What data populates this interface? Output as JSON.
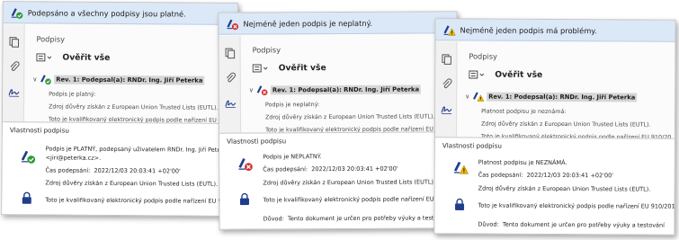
{
  "colors": {
    "status_bar": "#dbe8f7",
    "valid": "#2e9b3a",
    "invalid": "#d32f2f",
    "warning": "#f2b400",
    "pen": "#1f3d8a"
  },
  "panels": [
    {
      "status_text": "Podepsáno a všechny podpisy jsou platné.",
      "status_icon": "signature-valid-icon",
      "panel_title": "Podpisy",
      "verify_label": "Ověřit vše",
      "revision_label": "Rev. 1: Podepsal(a): RNDr. Ing. Jiří Peterka",
      "details": [
        "Podpis je platný:",
        "Zdroj důvěry získán z European Union Trusted Lists (EUTL).",
        "Toto je kvalifikovaný elektronický podpis podle nařízení EU 910/2"
      ],
      "dialog": {
        "title": "Vlastnosti podpisu",
        "summary_line1": "Podpis je PLATNÝ, podepsaný uživatelem RNDr. Ing. Jiří Peterka",
        "summary_line2": "<jiri@peterka.cz>.",
        "time_label": "Čas podepsání:",
        "time_value": "2022/12/03 20:03:41 +02'00'",
        "trust": "Zdroj důvěry získán z European Union Trusted Lists (EUTL).",
        "qualified": "Toto je kvalifikovaný elektronický podpis podle nařízení EU 910/2014"
      }
    },
    {
      "status_text": "Nejméně jeden podpis je neplatný.",
      "status_icon": "signature-invalid-icon",
      "panel_title": "Podpisy",
      "verify_label": "Ověřit vše",
      "revision_label": "Rev. 1: Podepsal(a): RNDr. Ing. Jiří Peterka",
      "details": [
        "Podpis je neplatný:",
        "Zdroj důvěry získán z European Union Trusted Lists (EUTL).",
        "Toto je kvalifikovaný elektronický podpis podle nařízení EU 910/20"
      ],
      "dialog": {
        "title": "Vlastnosti podpisu",
        "summary_line1": "Podpis je NEPLATNÝ.",
        "time_label": "Čas podepsání:",
        "time_value": "2022/12/03 20:03:41 +02'00'",
        "trust": "Zdroj důvěry získán z European Union Trusted Lists (EUTL).",
        "qualified": "Toto je kvalifikovaný elektronický podpis podle nařízení EU 910/2014",
        "reason_label": "Důvod:",
        "reason_value": "Tento dokument je určen pro potřeby výuky a testování"
      }
    },
    {
      "status_text": "Nejméně jeden podpis má problémy.",
      "status_icon": "signature-warning-icon",
      "panel_title": "Podpisy",
      "verify_label": "Ověřit vše",
      "revision_label": "Rev. 1: Podepsal(a): RNDr. Ing. Jiří Peterka",
      "details": [
        "Platnost podpisu je neznámá:",
        "Zdroj důvěry získán z European Union Trusted Lists (EUTL).",
        "Toto je kvalifikovaný elektronický podpis podle nařízení EU 910/20"
      ],
      "dialog": {
        "title": "Vlastnosti podpisu",
        "summary_line1": "Platnost podpisu je NEZNÁMÁ.",
        "time_label": "Čas podepsání:",
        "time_value": "2022/12/03 20:03:41 +02'00'",
        "trust": "Zdroj důvěry získán z European Union Trusted Lists (EUTL).",
        "qualified": "Toto je kvalifikovaný elektronický podpis podle nařízení EU 910/2014",
        "reason_label": "Důvod:",
        "reason_value": "Tento dokument je určen pro potřeby výuky a testování"
      }
    }
  ]
}
